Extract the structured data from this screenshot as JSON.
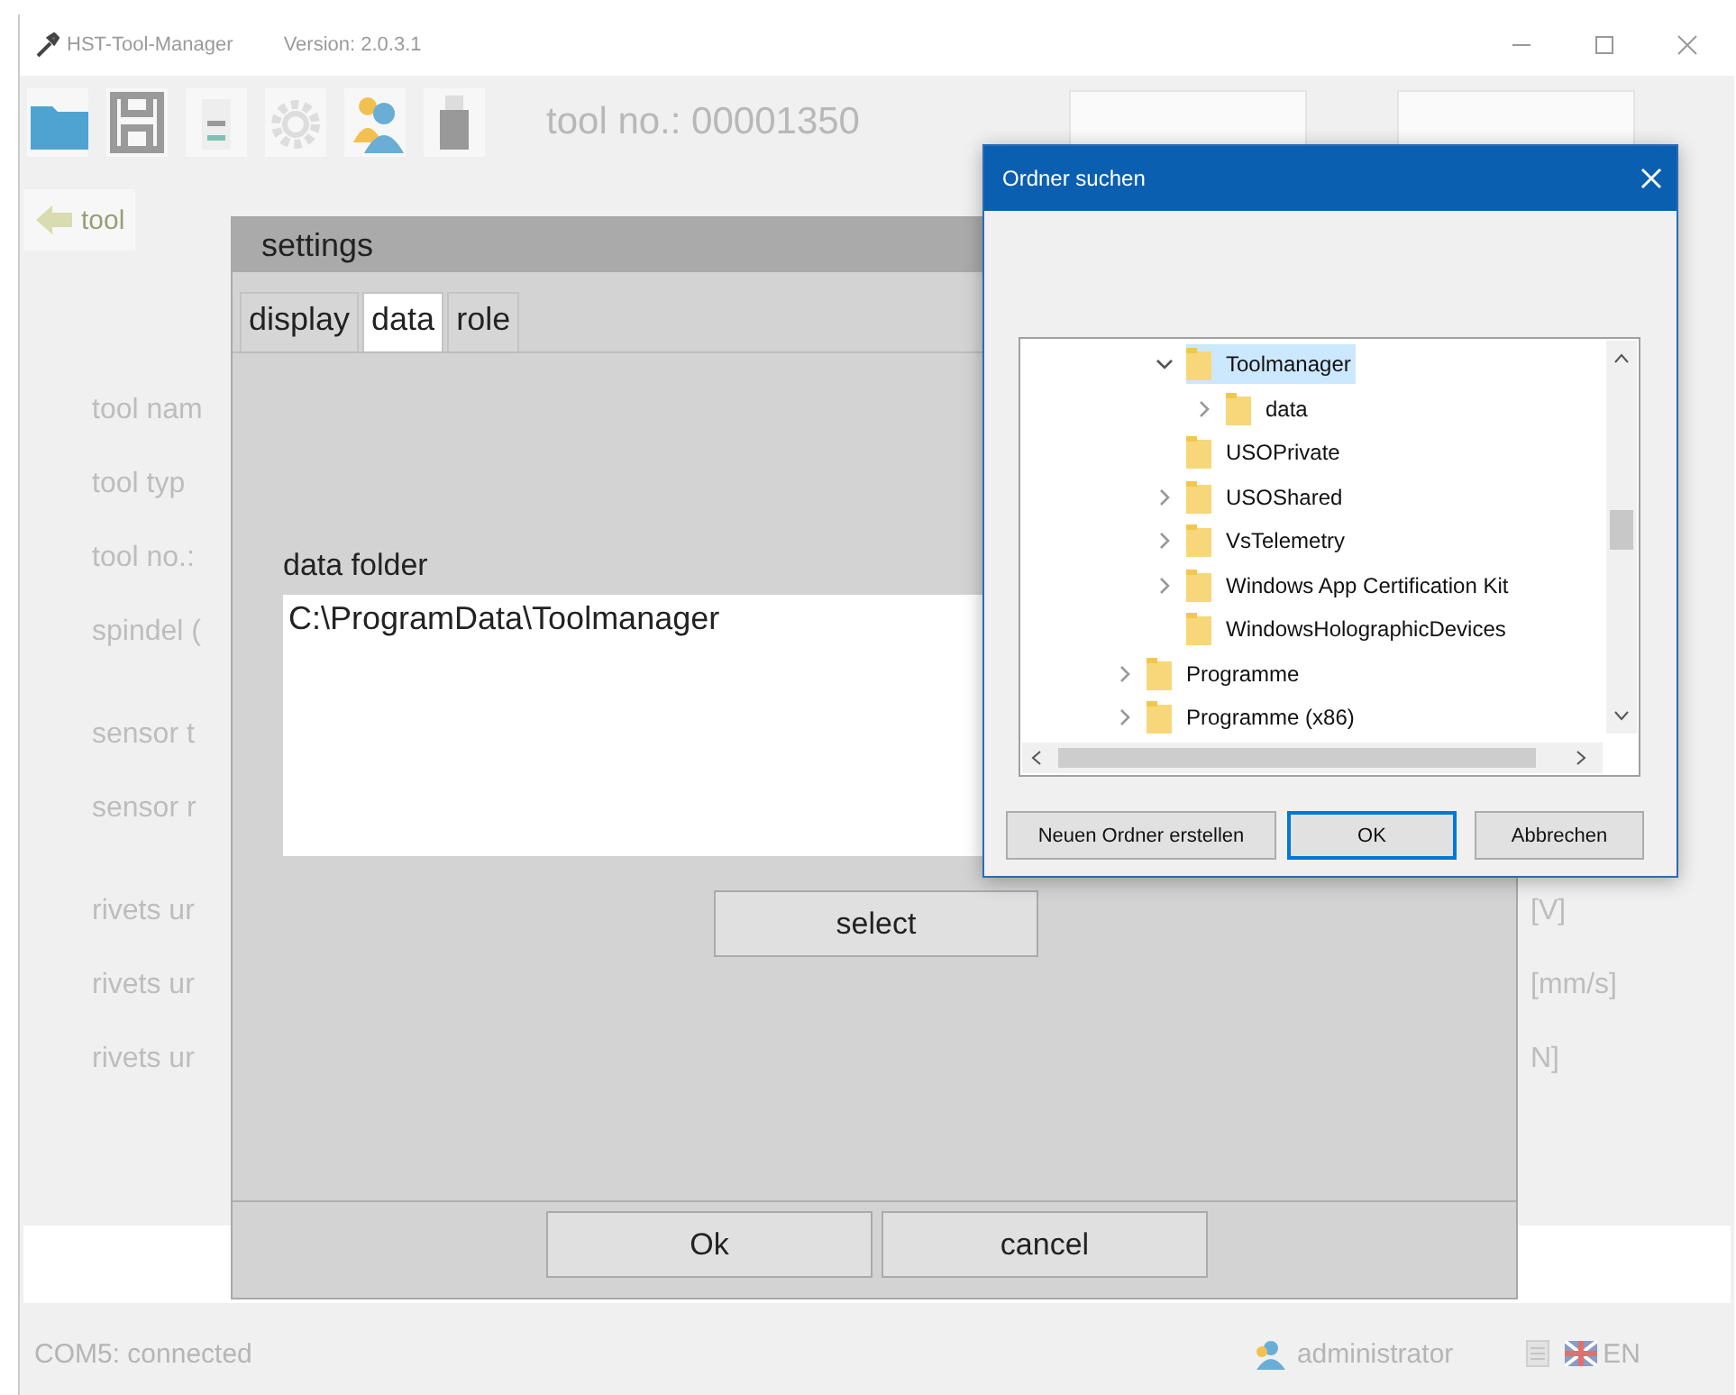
{
  "window": {
    "title": "HST-Tool-Manager",
    "version": "Version: 2.0.3.1"
  },
  "toolbar": {
    "tool_number": "tool no.: 00001350"
  },
  "nav": {
    "back_label": "tool"
  },
  "form": {
    "groups": [
      {
        "rows": [
          {
            "label": "tool nam"
          },
          {
            "label": "tool typ"
          },
          {
            "label": "tool no.:"
          },
          {
            "label": "spindel ("
          }
        ]
      },
      {
        "rows": [
          {
            "label": "sensor t"
          },
          {
            "label": "sensor r"
          }
        ]
      },
      {
        "rows": [
          {
            "label": "rivets ur",
            "unit": "[V]"
          },
          {
            "label": "rivets ur",
            "unit": "[mm/s]"
          },
          {
            "label": "rivets ur",
            "unit": "N]"
          }
        ]
      }
    ]
  },
  "status_bar": {
    "connection": "COM5: connected",
    "user": "administrator",
    "language": "EN"
  },
  "settings_dialog": {
    "title": "settings",
    "tabs": [
      {
        "label": "display",
        "selected": false
      },
      {
        "label": "data",
        "selected": true
      },
      {
        "label": "role",
        "selected": false
      }
    ],
    "folder_label": "data folder",
    "folder_path": "C:\\ProgramData\\Toolmanager",
    "select_button": "select",
    "buttons": [
      "Ok",
      "cancel"
    ]
  },
  "folder_dialog": {
    "title": "Ordner suchen",
    "tree": [
      {
        "children": [
          {
            "label": "Toolmanager",
            "expandable": true,
            "expanded": true,
            "selected": true,
            "children": [
              {
                "label": "data",
                "expandable": true,
                "expanded": false,
                "selected": false
              }
            ]
          },
          {
            "label": "USOPrivate",
            "expandable": false,
            "selected": false
          },
          {
            "label": "USOShared",
            "expandable": true,
            "expanded": false,
            "selected": false
          },
          {
            "label": "VsTelemetry",
            "expandable": true,
            "expanded": false,
            "selected": false
          },
          {
            "label": "Windows App Certification Kit",
            "expandable": true,
            "expanded": false,
            "selected": false
          },
          {
            "label": "WindowsHolographicDevices",
            "expandable": false,
            "selected": false
          }
        ]
      },
      {
        "label": "Programme",
        "expandable": true,
        "expanded": false,
        "selected": false
      },
      {
        "label": "Programme (x86)",
        "expandable": true,
        "expanded": false,
        "selected": false
      }
    ],
    "buttons": [
      {
        "label": "Neuen Ordner erstellen",
        "default": false
      },
      {
        "label": "OK",
        "default": true
      },
      {
        "label": "Abbrechen",
        "default": false
      }
    ]
  }
}
